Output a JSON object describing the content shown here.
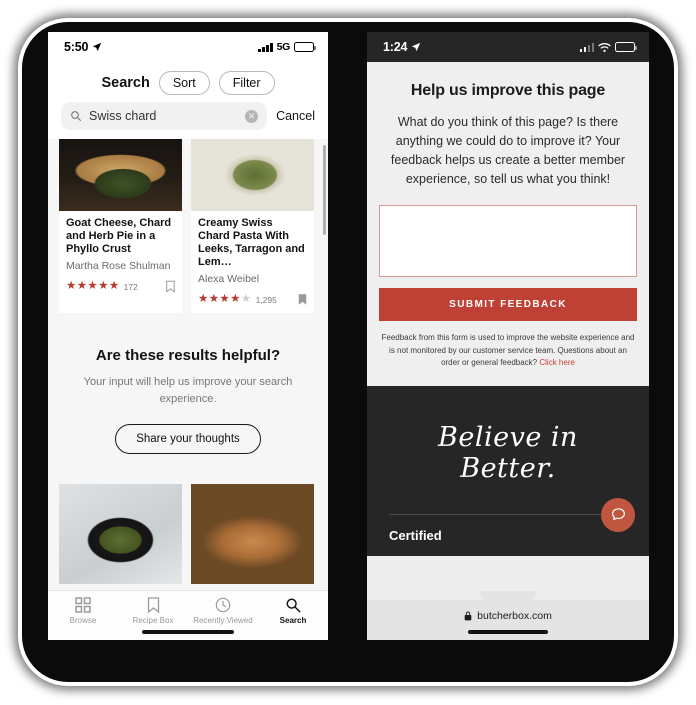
{
  "colors": {
    "brand_red": "#bf4035",
    "star_red": "#b63b2e",
    "fab": "#c0563f",
    "dark_panel": "#262626",
    "backdrop": "#0b0b0b"
  },
  "left_phone": {
    "statusbar": {
      "time": "5:50",
      "network": "5G",
      "location_icon": "location-arrow-icon",
      "battery_icon": "battery-full-icon",
      "signal_icon": "cellular-signal-icon"
    },
    "header": {
      "title": "Search",
      "sort_label": "Sort",
      "filter_label": "Filter"
    },
    "search": {
      "query": "Swiss chard",
      "placeholder": "Search",
      "cancel_label": "Cancel",
      "search_icon": "search-icon",
      "clear_icon": "clear-circle-icon",
      "clear_glyph": "✕"
    },
    "results": [
      {
        "title": "Goat Cheese, Chard and Herb Pie in a Phyllo Crust",
        "author": "Martha Rose Shulman",
        "stars_full": 5,
        "stars_total": 5,
        "ratings_count": "172",
        "saved": false,
        "image": "goat-cheese-chard-pie-photo"
      },
      {
        "title": "Creamy Swiss Chard Pasta With Leeks, Tarragon and Lem…",
        "author": "Alexa Weibel",
        "stars_full": 4,
        "stars_total": 5,
        "ratings_count": "1,295",
        "saved": true,
        "image": "creamy-swiss-chard-pasta-photo"
      }
    ],
    "feedback_prompt": {
      "heading": "Are these results helpful?",
      "body": "Your input will help us improve your search experience.",
      "button_label": "Share your thoughts"
    },
    "second_row": [
      {
        "image": "skillet-greens-eggs-photo"
      },
      {
        "image": "penne-pasta-photo"
      }
    ],
    "tabbar": [
      {
        "label": "Browse",
        "icon": "grid-icon",
        "active": false
      },
      {
        "label": "Recipe Box",
        "icon": "bookmark-icon",
        "active": false
      },
      {
        "label": "Recently Viewed",
        "icon": "clock-icon",
        "active": false
      },
      {
        "label": "Search",
        "icon": "search-icon",
        "active": true
      }
    ]
  },
  "right_phone": {
    "statusbar": {
      "time": "1:24",
      "location_icon": "location-arrow-icon",
      "wifi_icon": "wifi-icon",
      "battery_icon": "battery-low-icon",
      "signal_icon": "cellular-signal-icon"
    },
    "form": {
      "heading": "Help us improve this page",
      "body": "What do you think of this page? Is there anything we could do to improve it? Your feedback helps us create a better member experience, so tell us what you think!",
      "textarea_value": "",
      "textarea_placeholder": "",
      "submit_label": "SUBMIT FEEDBACK",
      "fineprint": "Feedback from this form is used to improve the website experience and is not monitored by our customer service team. Questions about an order or general feedback?",
      "fineprint_link": "Click here"
    },
    "footer": {
      "tagline": "Believe in Better.",
      "certified_label": "Certified",
      "chat_icon": "chat-bubble-icon"
    },
    "urlbar": {
      "lock_icon": "lock-icon",
      "url": "butcherbox.com"
    }
  }
}
